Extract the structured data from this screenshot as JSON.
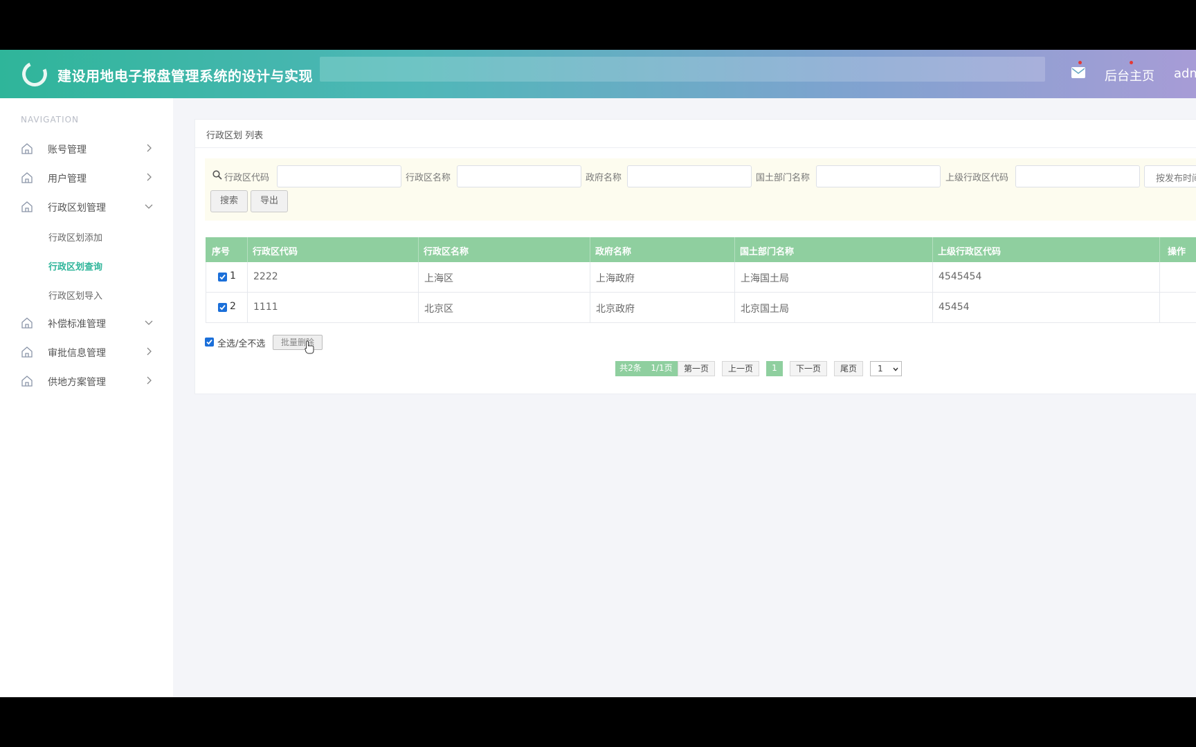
{
  "header": {
    "title": "建设用地电子报盘管理系统的设计与实现",
    "home_link": "后台主页",
    "user": "adm"
  },
  "sidebar": {
    "caption": "NAVIGATION",
    "items": [
      {
        "label": "账号管理",
        "chevron": "right"
      },
      {
        "label": "用户管理",
        "chevron": "right"
      },
      {
        "label": "行政区划管理",
        "chevron": "down"
      },
      {
        "label": "补偿标准管理",
        "chevron": "down"
      },
      {
        "label": "审批信息管理",
        "chevron": "right"
      },
      {
        "label": "供地方案管理",
        "chevron": "right"
      }
    ],
    "subitems": [
      {
        "label": "行政区划添加",
        "active": false
      },
      {
        "label": "行政区划查询",
        "active": true
      },
      {
        "label": "行政区划导入",
        "active": false
      }
    ]
  },
  "card": {
    "title": "行政区划 列表"
  },
  "search": {
    "fields": [
      "行政区代码",
      "行政区名称",
      "政府名称",
      "国土部门名称",
      "上级行政区代码"
    ],
    "sort_button": "按发布时间",
    "search_button": "搜索",
    "export_button": "导出"
  },
  "table": {
    "headers": [
      "序号",
      "行政区代码",
      "行政区名称",
      "政府名称",
      "国土部门名称",
      "上级行政区代码",
      "操作"
    ],
    "rows": [
      {
        "no": "1",
        "code": "2222",
        "name": "上海区",
        "gov": "上海政府",
        "dept": "上海国土局",
        "parent": "4545454",
        "checked": true
      },
      {
        "no": "2",
        "code": "1111",
        "name": "北京区",
        "gov": "北京政府",
        "dept": "北京国土局",
        "parent": "45454",
        "checked": true
      }
    ]
  },
  "footer": {
    "select_all": "全选/全不选",
    "batch_delete": "批量删除"
  },
  "pager": {
    "total": "共2条",
    "pages": "1/1页",
    "first": "第一页",
    "prev": "上一页",
    "current": "1",
    "next": "下一页",
    "last": "尾页",
    "select_value": "1"
  },
  "colors": {
    "accent": "#2fb59a",
    "table_header": "#8fcf9f",
    "checkbox": "#1b6fd9"
  }
}
